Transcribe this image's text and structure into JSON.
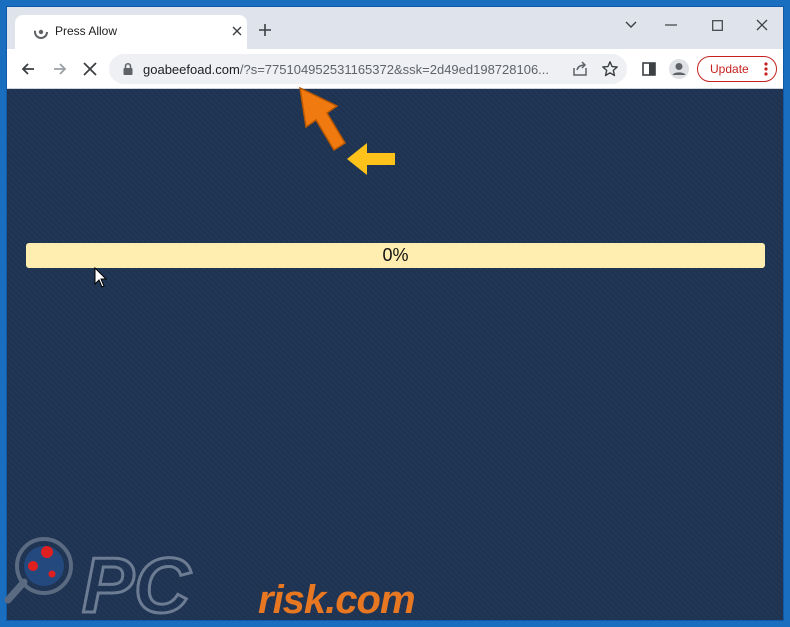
{
  "tab": {
    "title": "Press Allow",
    "favicon": "loading-favicon-icon"
  },
  "window_controls": [
    "chevron-down-icon",
    "minimize-icon",
    "maximize-icon",
    "close-icon"
  ],
  "toolbar": {
    "url_domain": "goabeefoad.com",
    "url_rest": "/?s=775104952531165372&ssk=2d49ed198728106...",
    "update_label": "Update"
  },
  "page": {
    "progress_text": "0%",
    "progress_value": 0
  },
  "watermark": {
    "brand_text": "risk.com"
  },
  "colors": {
    "content_bg": "#1e3252",
    "progress_bg": "#ffeeb0",
    "update_red": "#c5221f",
    "arrow_orange": "#f07a10",
    "arrow_yellow": "#ffc21a"
  }
}
